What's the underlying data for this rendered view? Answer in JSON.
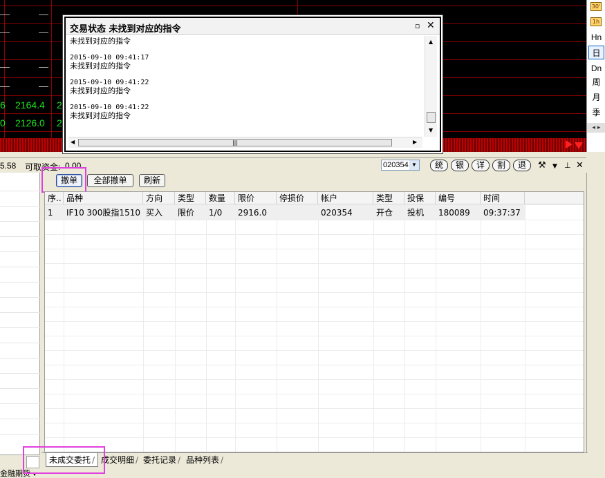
{
  "market": {
    "row1": [
      "—",
      "—"
    ],
    "row2": [
      "—",
      "—"
    ],
    "row3": [
      "—",
      "—"
    ],
    "row4": [
      "—",
      "—"
    ],
    "row5": [
      "6",
      "2164.4",
      "2"
    ],
    "row6": [
      "0",
      "2126.0",
      "2"
    ],
    "partial": "0.0"
  },
  "period_toolbar": {
    "icon_30": "30'",
    "icon_1h": "1h",
    "items": [
      "Hn",
      "日",
      "Dn",
      "周",
      "月",
      "季"
    ],
    "selected": "日",
    "scroll": "◂ ▸"
  },
  "infobar": {
    "balance": "5.58",
    "available_label": "可取资金:",
    "available_value": "0.00",
    "account": "020354",
    "buttons": [
      "统",
      "银",
      "详",
      "割",
      "退"
    ]
  },
  "popup": {
    "title": "交易状态 未找到对应的指令",
    "pin": "▫",
    "close": "✕",
    "entries": [
      {
        "time": "",
        "message": "未找到对应的指令"
      },
      {
        "time": "2015-09-10 09:41:17",
        "message": "未找到对应的指令"
      },
      {
        "time": "2015-09-10 09:41:22",
        "message": "未找到对应的指令"
      },
      {
        "time": "2015-09-10 09:41:22",
        "message": "未找到对应的指令"
      }
    ]
  },
  "actions": {
    "cancel": "撤单",
    "cancel_all": "全部撤单",
    "refresh": "刷新"
  },
  "table": {
    "columns": [
      "序..",
      "品种",
      "方向",
      "类型",
      "数量",
      "限价",
      "停损价",
      "帐户",
      "类型",
      "投保",
      "编号",
      "时间"
    ],
    "rows": [
      [
        "1",
        "IF10 300股指1510",
        "买入",
        "限价",
        "1/0",
        "2916.0",
        "",
        "020354",
        "开仓",
        "投机",
        "180089",
        "09:37:37"
      ]
    ]
  },
  "tabs": [
    "未成交委托",
    "成交明细",
    "委托记录",
    "品种列表"
  ],
  "bottom": {
    "label": "金融期货"
  },
  "colors": {
    "highlight": "#e040e0",
    "market_bg": "#000000",
    "grid_line": "#8b0000"
  }
}
